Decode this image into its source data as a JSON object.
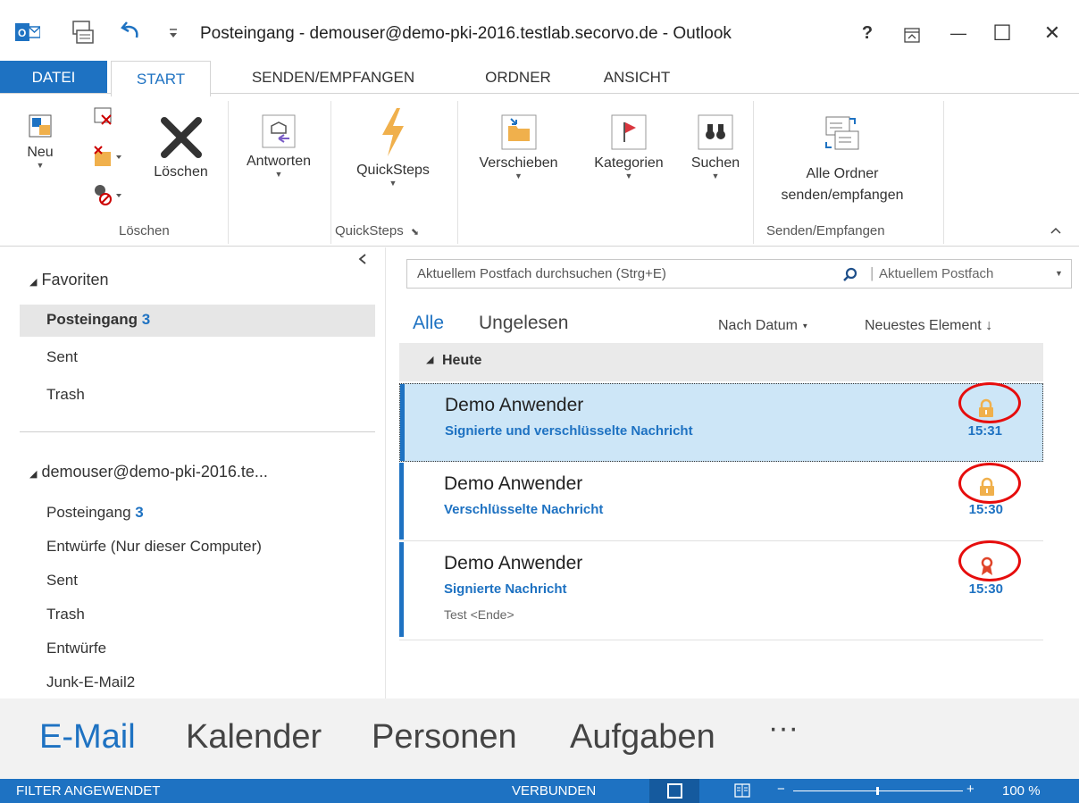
{
  "window": {
    "title": "Posteingang - demouser@demo-pki-2016.testlab.secorvo.de - Outlook",
    "help": "?",
    "min": "—",
    "max": "☐",
    "close": "✕"
  },
  "tabs": [
    "DATEI",
    "START",
    "SENDEN/EMPFANGEN",
    "ORDNER",
    "ANSICHT"
  ],
  "ribbon": {
    "neu": "Neu",
    "loeschen_btn": "Löschen",
    "antworten": "Antworten",
    "quicksteps": "QuickSteps",
    "verschieben": "Verschieben",
    "kategorien": "Kategorien",
    "suchen": "Suchen",
    "alle_ordner_1": "Alle Ordner",
    "alle_ordner_2": "senden/empfangen",
    "group_loeschen": "Löschen",
    "group_quicksteps": "QuickSteps",
    "group_senden": "Senden/Empfangen"
  },
  "folders": {
    "favoriten": "Favoriten",
    "fav_items": [
      {
        "label": "Posteingang",
        "count": "3"
      },
      {
        "label": "Sent",
        "count": ""
      },
      {
        "label": "Trash",
        "count": ""
      }
    ],
    "account": "demouser@demo-pki-2016.te...",
    "account_items": [
      {
        "label": "Posteingang",
        "count": "3"
      },
      {
        "label": "Entwürfe (Nur dieser Computer)",
        "count": ""
      },
      {
        "label": "Sent",
        "count": ""
      },
      {
        "label": "Trash",
        "count": ""
      },
      {
        "label": "Entwürfe",
        "count": ""
      },
      {
        "label": "Junk-E-Mail2",
        "count": ""
      }
    ]
  },
  "search": {
    "placeholder": "Aktuellem Postfach durchsuchen (Strg+E)",
    "scope": "Aktuellem Postfach"
  },
  "filters": {
    "alle": "Alle",
    "ungelesen": "Ungelesen",
    "sort": "Nach Datum",
    "order": "Neuestes Element"
  },
  "group_heading": "Heute",
  "messages": [
    {
      "sender": "Demo Anwender",
      "subject": "Signierte und verschlüsselte  Nachricht",
      "time": "15:31",
      "preview": "",
      "icon": "lock-icon",
      "selected": true
    },
    {
      "sender": "Demo Anwender",
      "subject": "Verschlüsselte Nachricht",
      "time": "15:30",
      "preview": "",
      "icon": "lock-icon",
      "selected": false
    },
    {
      "sender": "Demo Anwender",
      "subject": "Signierte Nachricht",
      "time": "15:30",
      "preview": "Test <Ende>",
      "icon": "certificate-ribbon-icon",
      "selected": false
    }
  ],
  "nav": {
    "mail": "E-Mail",
    "kalender": "Kalender",
    "personen": "Personen",
    "aufgaben": "Aufgaben",
    "more": "···"
  },
  "status": {
    "filter": "FILTER ANGEWENDET",
    "connection": "VERBUNDEN",
    "zoom": "100 %"
  },
  "colors": {
    "accent": "#1e72c2",
    "selected_row": "#cde6f7",
    "annotation": "#e60d0d",
    "lock": "#f0b04c"
  }
}
